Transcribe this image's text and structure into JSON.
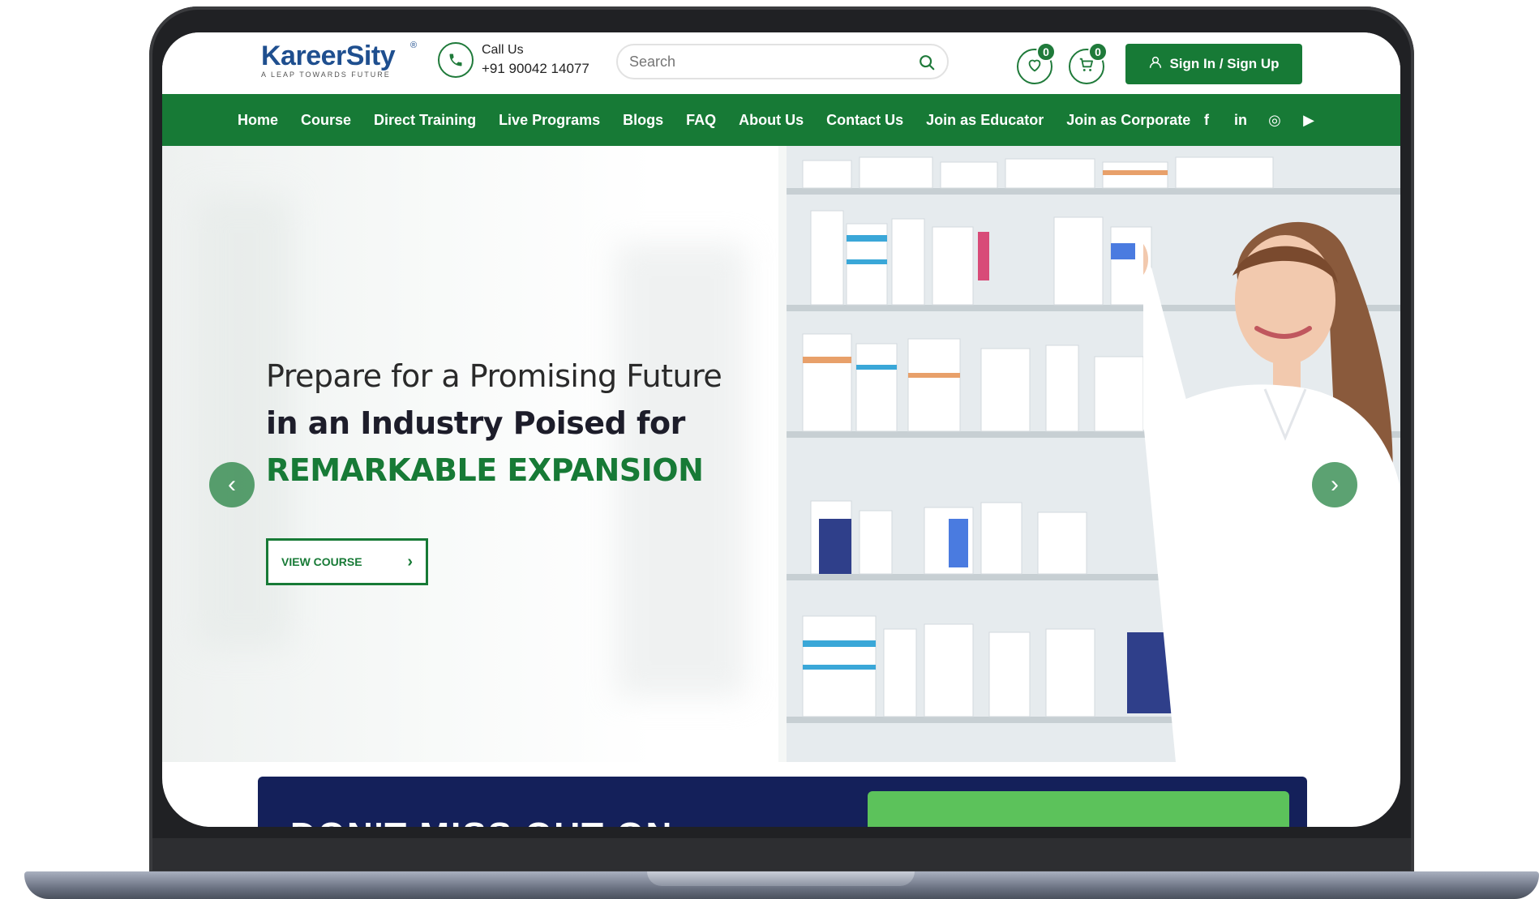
{
  "brand": {
    "name": "KareerSity",
    "reg": "®",
    "tagline": "A LEAP TOWARDS FUTURE"
  },
  "contact": {
    "label": "Call Us",
    "phone": "+91 90042 14077"
  },
  "search": {
    "placeholder": "Search"
  },
  "wishlist": {
    "count": "0"
  },
  "cart": {
    "count": "0"
  },
  "auth": {
    "label": "Sign In / Sign Up"
  },
  "nav": {
    "items": [
      "Home",
      "Course",
      "Direct Training",
      "Live Programs",
      "Blogs",
      "FAQ",
      "About Us",
      "Contact Us",
      "Join as Educator",
      "Join as Corporate"
    ]
  },
  "social": {
    "facebook": "f",
    "linkedin": "in",
    "instagram": "◎",
    "youtube": "▶"
  },
  "hero": {
    "line1": "Prepare for a Promising Future",
    "line2": "in an Industry Poised for",
    "line3": "REMARKABLE EXPANSION",
    "cta": "VIEW COURSE",
    "cta_chevron": "›",
    "prev": "‹",
    "next": "›"
  },
  "banner": {
    "text": "DON'T MISS OUT ON"
  },
  "colors": {
    "brand_green": "#177a36",
    "brand_blue": "#1f4f8f",
    "banner_navy": "#14205a"
  }
}
